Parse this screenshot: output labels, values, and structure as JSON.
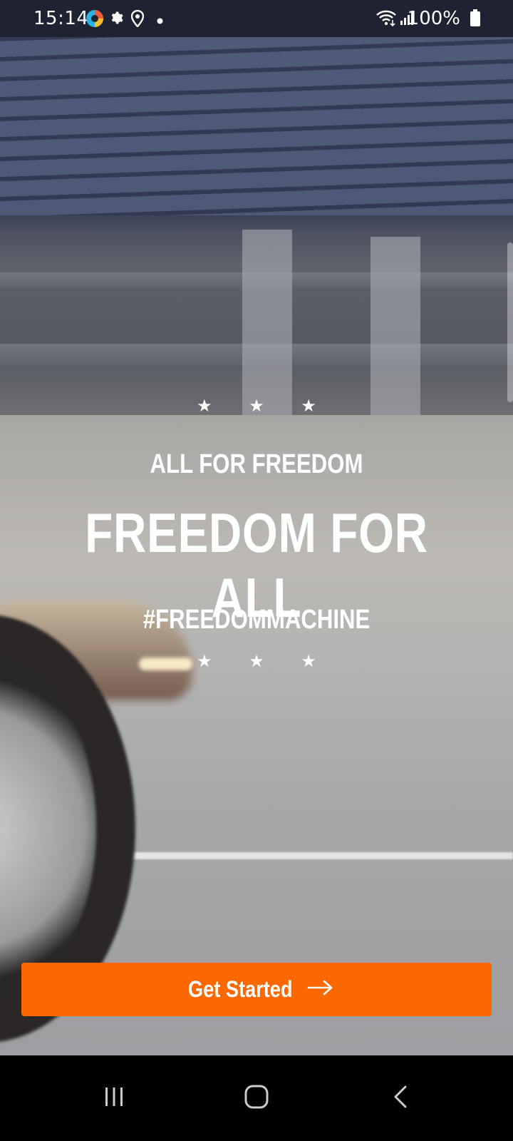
{
  "status_bar": {
    "time": "15:14",
    "battery_percent": "100%",
    "icons": [
      "app-notification-icon",
      "settings-gear-icon",
      "location-pin-icon",
      "dot-icon",
      "wifi-icon",
      "signal-icon",
      "battery-icon"
    ]
  },
  "hero": {
    "subtitle": "ALL FOR FREEDOM",
    "title": "FREEDOM FOR ALL",
    "hashtag": "#FREEDOMMACHINE",
    "stars_top": "★ ★ ★",
    "stars_bottom": "★ ★ ★"
  },
  "cta": {
    "label": "Get Started",
    "color": "#fb6700"
  },
  "nav_bar": {
    "buttons": [
      "recent-apps",
      "home",
      "back"
    ]
  },
  "colors": {
    "accent": "#fb6700",
    "status_bar_bg": "#1f2230",
    "text": "#ffffff"
  }
}
